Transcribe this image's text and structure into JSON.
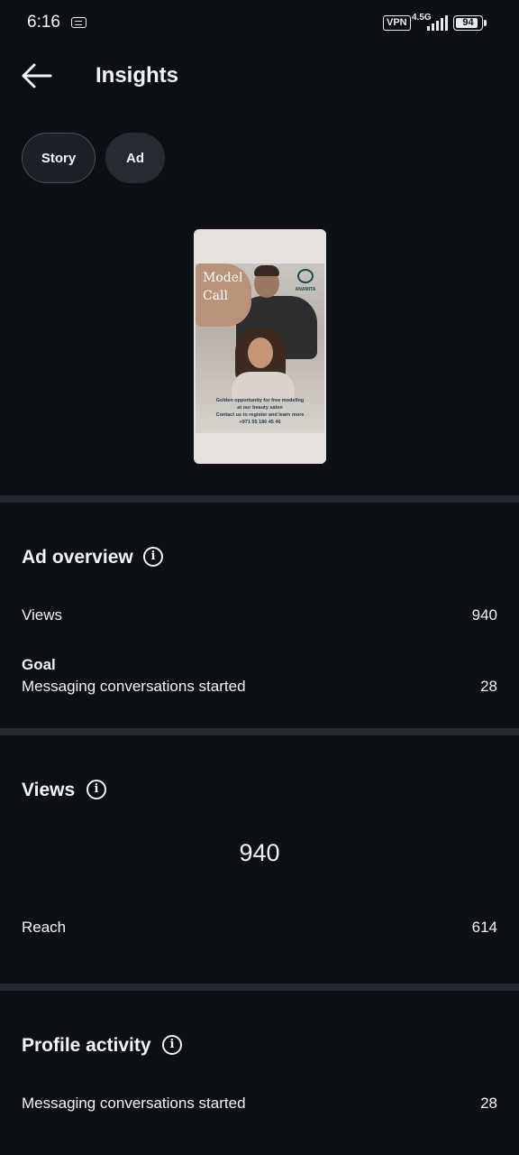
{
  "status_bar": {
    "time": "6:16",
    "vpn": "VPN",
    "network": "4.5G",
    "battery": "94",
    "battery_level": 0.94
  },
  "header": {
    "title": "Insights",
    "back_icon": "arrow-left-icon"
  },
  "tabs": [
    {
      "label": "Story",
      "selected": true
    },
    {
      "label": "Ad",
      "selected": false
    }
  ],
  "preview": {
    "headline": "Model Call",
    "brand": "ANAMITA",
    "caption": [
      "Golden opportunity for free modeling",
      "at our beauty salon",
      "Contact us to register and learn more",
      "+971 55 186 45 46"
    ]
  },
  "ad_overview": {
    "title": "Ad overview",
    "views_label": "Views",
    "views_value": "940",
    "goal_label": "Goal",
    "goal_metric_label": "Messaging conversations started",
    "goal_metric_value": "28"
  },
  "views_section": {
    "title": "Views",
    "total": "940",
    "reach_label": "Reach",
    "reach_value": "614"
  },
  "profile_activity": {
    "title": "Profile activity",
    "metric_label": "Messaging conversations started",
    "metric_value": "28"
  },
  "colors": {
    "background": "#0c0f14",
    "divider": "#262a30",
    "text": "#f2f4f7",
    "chip": "#262b33"
  }
}
